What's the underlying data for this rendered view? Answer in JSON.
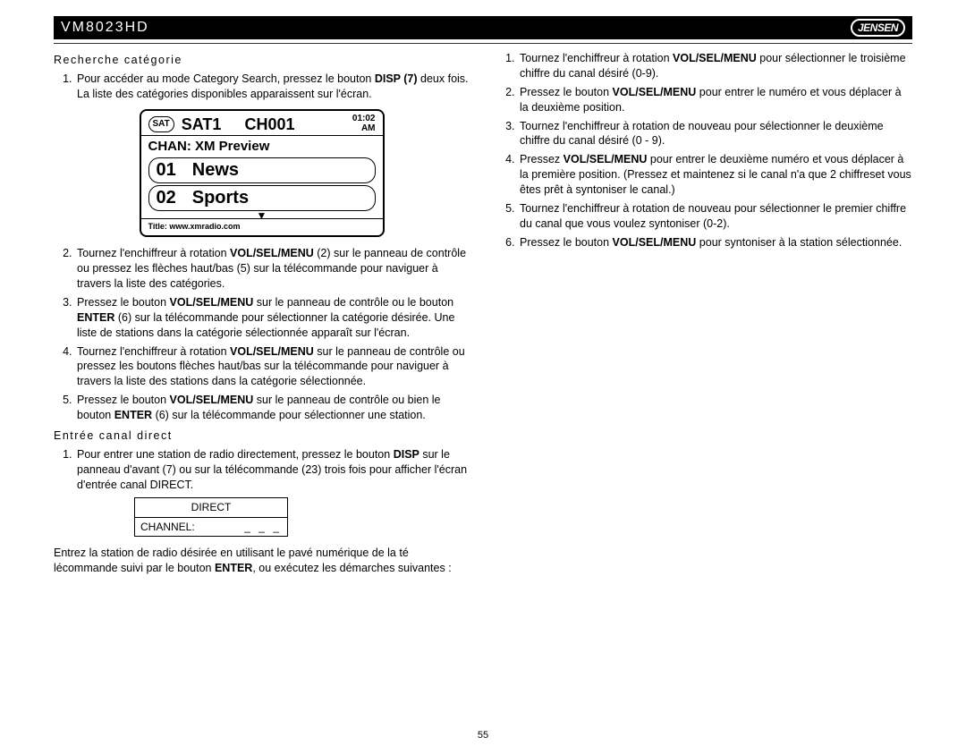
{
  "header": {
    "model": "VM8023HD",
    "brand": "JENSEN"
  },
  "page_number": "55",
  "left": {
    "section1_title": "Recherche catégorie",
    "s1_items": [
      {
        "pre": "Pour accéder au mode Category Search, pressez le bouton ",
        "bold": "DISP (7)",
        "post": " deux fois. La liste des catégories disponibles apparaissent sur l'écran."
      }
    ],
    "sat": {
      "badge": "SAT",
      "sat1": "SAT1",
      "ch": "CH001",
      "time": "01:02",
      "ampm": "AM",
      "chan_line": "CHAN: XM Preview",
      "row1_num": "01",
      "row1_label": "News",
      "row2_num": "02",
      "row2_label": "Sports",
      "footer": "Title: www.xmradio.com"
    },
    "s1_items_b": [
      {
        "pre": "Tournez l'enchiffreur à rotation ",
        "bold": "VOL/SEL/MENU",
        "post": " (2) sur le panneau de contrôle ou pressez les flèches haut/bas (5) sur la télécommande pour naviguer à travers la liste des catégories."
      },
      {
        "pre": "Pressez le bouton ",
        "bold": "VOL/SEL/MENU",
        "mid": " sur le panneau de contrôle ou le bouton ",
        "bold2": "ENTER",
        "post": " (6) sur la télécommande pour sélectionner la catégorie désirée. Une liste de stations dans la catégorie sélectionnée apparaît sur l'écran."
      },
      {
        "pre": "Tournez l'enchiffreur à rotation ",
        "bold": "VOL/SEL/MENU",
        "post": " sur le panneau de contrôle ou pressez les boutons flèches haut/bas sur la télécommande pour naviguer à travers la liste des stations dans la catégorie sélectionnée."
      },
      {
        "pre": "Pressez le bouton ",
        "bold": "VOL/SEL/MENU",
        "mid": " sur le panneau de contrôle ou bien le bouton ",
        "bold2": "ENTER",
        "post": " (6) sur la télécommande pour sélectionner une station."
      }
    ],
    "section2_title": "Entrée canal direct",
    "s2_item1": {
      "pre": "Pour entrer une station de radio directement, pressez le bouton ",
      "bold": "DISP",
      "post": " sur le panneau d'avant (7) ou sur la télécommande (23) trois fois pour afficher l'écran d'entrée canal DIRECT."
    },
    "direct": {
      "top": "DIRECT",
      "label": "CHANNEL:",
      "value": "_ _ _"
    },
    "s2_outro_pre": "Entrez la station de radio désirée en utilisant le pavé numérique de la té lécommande suivi par le bouton ",
    "s2_outro_bold": "ENTER",
    "s2_outro_post": ", ou exécutez les démarches suivantes :"
  },
  "right": {
    "items": [
      {
        "pre": "Tournez l'enchiffreur à rotation ",
        "bold": "VOL/SEL/MENU",
        "post": " pour sélectionner le troisième chiffre du canal désiré (0-9)."
      },
      {
        "pre": "Pressez le bouton ",
        "bold": "VOL/SEL/MENU",
        "post": " pour entrer le numéro et vous déplacer à la deuxième position."
      },
      {
        "pre": "Tournez l'enchiffreur à rotation de nouveau pour sélectionner le deuxième chiffre du canal désiré (0 - 9).",
        "bold": "",
        "post": ""
      },
      {
        "pre": "Pressez ",
        "bold": "VOL/SEL/MENU",
        "post": " pour entrer le deuxième numéro et vous déplacer à la première position. (Pressez et maintenez si le canal n'a que 2 chiffreset vous êtes prêt à syntoniser le canal.)"
      },
      {
        "pre": "Tournez l'enchiffreur à rotation de nouveau pour sélectionner le premier chiffre du canal que vous voulez syntoniser (0-2).",
        "bold": "",
        "post": ""
      },
      {
        "pre": "Pressez le bouton ",
        "bold": "VOL/SEL/MENU",
        "post": " pour syntoniser à la station sélectionnée."
      }
    ]
  }
}
